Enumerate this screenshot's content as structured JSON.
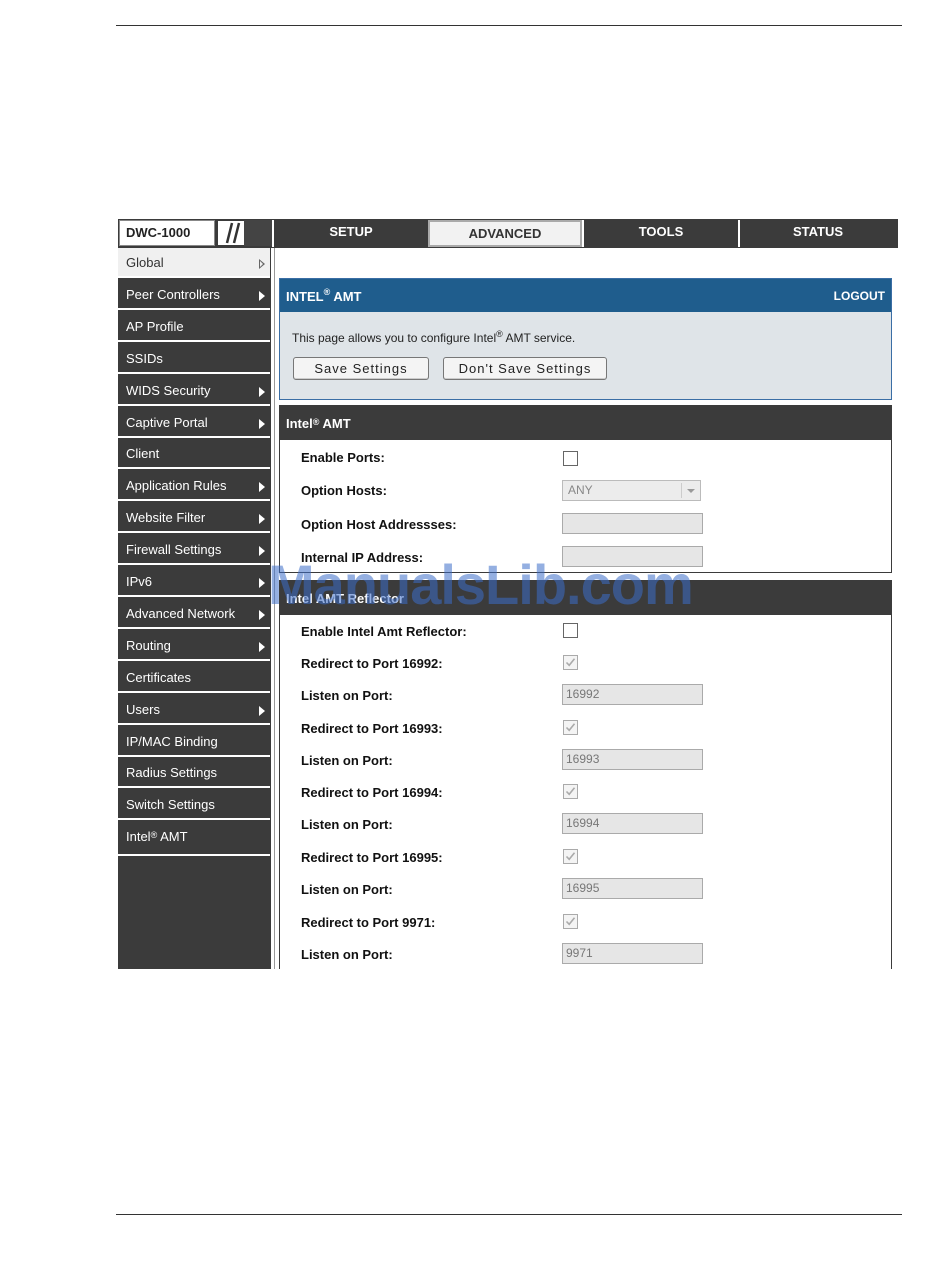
{
  "brand": {
    "model": "DWC-1000"
  },
  "nav": {
    "tabs": [
      "SETUP",
      "ADVANCED",
      "TOOLS",
      "STATUS"
    ],
    "active": "ADVANCED"
  },
  "sidebar": {
    "items": [
      {
        "label": "Global",
        "active": true
      },
      {
        "label": "Peer Controllers",
        "arrow": true
      },
      {
        "label": "AP Profile"
      },
      {
        "label": "SSIDs"
      },
      {
        "label": "WIDS Security",
        "arrow": true
      },
      {
        "label": "Captive Portal",
        "arrow": true
      },
      {
        "label": "Client"
      },
      {
        "label": "Application Rules",
        "arrow": true
      },
      {
        "label": "Website Filter",
        "arrow": true
      },
      {
        "label": "Firewall Settings",
        "arrow": true
      },
      {
        "label": "IPv6",
        "arrow": true
      },
      {
        "label": "Advanced Network",
        "arrow": true
      },
      {
        "label": "Routing",
        "arrow": true
      },
      {
        "label": "Certificates"
      },
      {
        "label": "Users",
        "arrow": true
      },
      {
        "label": "IP/MAC Binding"
      },
      {
        "label": "Radius Settings"
      },
      {
        "label": "Switch Settings"
      },
      {
        "label_prefix": "Intel",
        "label_sup": "®",
        "label_suffix": " AMT"
      }
    ]
  },
  "intro": {
    "title_prefix": "INTEL",
    "title_sup": "®",
    "title_suffix": " AMT",
    "logout": "LOGOUT",
    "text_prefix": "This page allows you to configure Intel",
    "text_sup": "®",
    "text_suffix": " AMT service.",
    "save_label": "Save Settings",
    "dont_save_label": "Don't Save Settings"
  },
  "amt": {
    "title_prefix": "Intel",
    "title_sup": "®",
    "title_suffix": " AMT",
    "enable_ports_label": "Enable Ports:",
    "option_hosts_label": "Option Hosts:",
    "option_hosts_value": "ANY",
    "option_host_addresses_label": "Option Host Addressses:",
    "internal_ip_label": "Internal IP Address:"
  },
  "reflector": {
    "title": "Intel AMT Reflector",
    "enable_label": "Enable Intel Amt Reflector:",
    "rows": [
      {
        "redirect_label": "Redirect to Port 16992:",
        "listen_label": "Listen on Port:",
        "port": "16992"
      },
      {
        "redirect_label": "Redirect to Port 16993:",
        "listen_label": "Listen on Port:",
        "port": "16993"
      },
      {
        "redirect_label": "Redirect to Port 16994:",
        "listen_label": "Listen on Port:",
        "port": "16994"
      },
      {
        "redirect_label": "Redirect to Port 16995:",
        "listen_label": "Listen on Port:",
        "port": "16995"
      },
      {
        "redirect_label": "Redirect to Port 9971:",
        "listen_label": "Listen on Port:",
        "port": "9971"
      }
    ]
  },
  "watermark": "ManualsLib.com"
}
